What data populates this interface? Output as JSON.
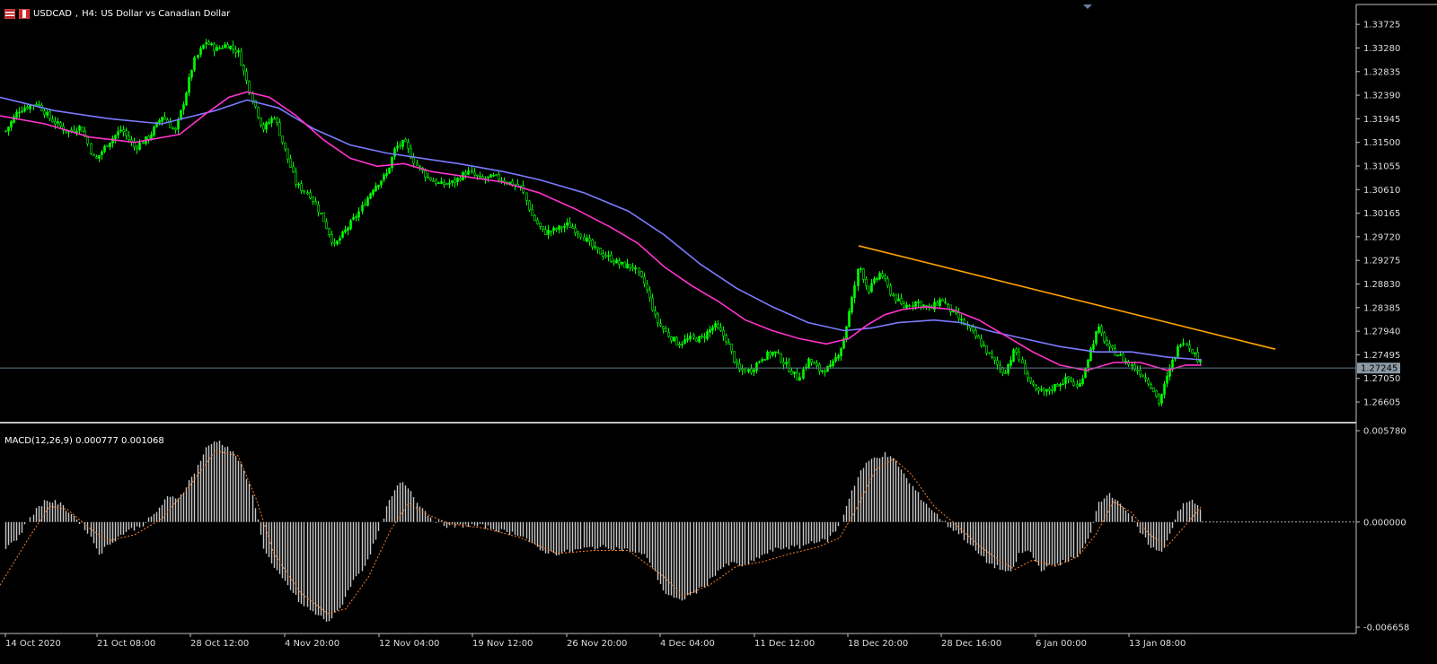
{
  "header": {
    "symbol": "USDCAD",
    "timeframe": "H4:",
    "description": "US Dollar vs Canadian Dollar"
  },
  "indicator": {
    "name": "MACD(12,26,9)",
    "main_value": "0.000777",
    "signal_value": "0.001068"
  },
  "current_price": "1.27245",
  "colors": {
    "background": "#000000",
    "bull_candle": "#00ff00",
    "ma_fast": "#ff33cc",
    "ma_slow": "#7b7bff",
    "trendline": "#ffa500",
    "macd_histogram": "#c8c8c8",
    "macd_signal": "#ff7f27",
    "axis": "#c0c0c0",
    "bid_line": "#607b8b"
  },
  "chart_data": [
    {
      "type": "candlestick",
      "title": "USDCAD, H4:  US Dollar vs Canadian Dollar",
      "x_tick_labels": [
        "14 Oct 2020",
        "21 Oct 08:00",
        "28 Oct 12:00",
        "4 Nov 20:00",
        "12 Nov 04:00",
        "19 Nov 12:00",
        "26 Nov 20:00",
        "4 Dec 04:00",
        "11 Dec 12:00",
        "18 Dec 20:00",
        "28 Dec 16:00",
        "6 Jan 00:00",
        "13 Jan 08:00"
      ],
      "y_tick_labels": [
        "1.33725",
        "1.33280",
        "1.32835",
        "1.32390",
        "1.31945",
        "1.31500",
        "1.31055",
        "1.30610",
        "1.30165",
        "1.29720",
        "1.29275",
        "1.28830",
        "1.28385",
        "1.27940",
        "1.27495",
        "1.27050",
        "1.26605"
      ],
      "ylim": [
        1.2625,
        1.341
      ],
      "close_path": [
        [
          0,
          1.3155
        ],
        [
          20,
          1.321
        ],
        [
          40,
          1.3225
        ],
        [
          55,
          1.3195
        ],
        [
          75,
          1.317
        ],
        [
          90,
          1.318
        ],
        [
          105,
          1.3115
        ],
        [
          120,
          1.315
        ],
        [
          135,
          1.3175
        ],
        [
          150,
          1.314
        ],
        [
          165,
          1.316
        ],
        [
          180,
          1.32
        ],
        [
          195,
          1.317
        ],
        [
          205,
          1.323
        ],
        [
          215,
          1.33
        ],
        [
          228,
          1.334
        ],
        [
          240,
          1.3325
        ],
        [
          252,
          1.3335
        ],
        [
          265,
          1.332
        ],
        [
          278,
          1.3245
        ],
        [
          292,
          1.3175
        ],
        [
          305,
          1.32
        ],
        [
          318,
          1.313
        ],
        [
          330,
          1.307
        ],
        [
          345,
          1.305
        ],
        [
          358,
          1.301
        ],
        [
          372,
          1.2955
        ],
        [
          385,
          1.2985
        ],
        [
          400,
          1.302
        ],
        [
          415,
          1.3065
        ],
        [
          430,
          1.309
        ],
        [
          440,
          1.314
        ],
        [
          450,
          1.315
        ],
        [
          462,
          1.311
        ],
        [
          475,
          1.3085
        ],
        [
          490,
          1.307
        ],
        [
          505,
          1.3075
        ],
        [
          520,
          1.3095
        ],
        [
          535,
          1.308
        ],
        [
          550,
          1.3085
        ],
        [
          565,
          1.3075
        ],
        [
          580,
          1.3065
        ],
        [
          592,
          1.301
        ],
        [
          605,
          1.298
        ],
        [
          618,
          1.2985
        ],
        [
          632,
          1.2995
        ],
        [
          645,
          1.298
        ],
        [
          660,
          1.295
        ],
        [
          675,
          1.2935
        ],
        [
          690,
          1.292
        ],
        [
          705,
          1.2915
        ],
        [
          718,
          1.288
        ],
        [
          730,
          1.2815
        ],
        [
          742,
          1.279
        ],
        [
          755,
          1.277
        ],
        [
          768,
          1.278
        ],
        [
          780,
          1.278
        ],
        [
          795,
          1.2805
        ],
        [
          808,
          1.278
        ],
        [
          822,
          1.272
        ],
        [
          835,
          1.272
        ],
        [
          848,
          1.2745
        ],
        [
          862,
          1.2755
        ],
        [
          875,
          1.273
        ],
        [
          888,
          1.2705
        ],
        [
          900,
          1.274
        ],
        [
          912,
          1.272
        ],
        [
          925,
          1.2725
        ],
        [
          938,
          1.277
        ],
        [
          948,
          1.285
        ],
        [
          956,
          1.292
        ],
        [
          966,
          1.287
        ],
        [
          980,
          1.2905
        ],
        [
          990,
          1.287
        ],
        [
          1005,
          1.284
        ],
        [
          1020,
          1.285
        ],
        [
          1035,
          1.2835
        ],
        [
          1048,
          1.2855
        ],
        [
          1060,
          1.283
        ],
        [
          1075,
          1.2805
        ],
        [
          1090,
          1.2775
        ],
        [
          1105,
          1.274
        ],
        [
          1118,
          1.2715
        ],
        [
          1130,
          1.276
        ],
        [
          1140,
          1.272
        ],
        [
          1152,
          1.268
        ],
        [
          1165,
          1.268
        ],
        [
          1178,
          1.2695
        ],
        [
          1190,
          1.2705
        ],
        [
          1200,
          1.2685
        ],
        [
          1210,
          1.274
        ],
        [
          1222,
          1.28
        ],
        [
          1235,
          1.276
        ],
        [
          1245,
          1.275
        ],
        [
          1258,
          1.273
        ],
        [
          1270,
          1.2715
        ],
        [
          1282,
          1.269
        ],
        [
          1290,
          1.266
        ],
        [
          1298,
          1.27
        ],
        [
          1306,
          1.274
        ],
        [
          1316,
          1.278
        ],
        [
          1326,
          1.276
        ],
        [
          1338,
          1.2728
        ]
      ],
      "ma_fast_path": [
        [
          0,
          1.32
        ],
        [
          50,
          1.3185
        ],
        [
          100,
          1.316
        ],
        [
          150,
          1.315
        ],
        [
          200,
          1.3165
        ],
        [
          230,
          1.3205
        ],
        [
          255,
          1.3235
        ],
        [
          275,
          1.3245
        ],
        [
          300,
          1.3235
        ],
        [
          330,
          1.32
        ],
        [
          360,
          1.3155
        ],
        [
          390,
          1.312
        ],
        [
          420,
          1.3105
        ],
        [
          450,
          1.311
        ],
        [
          480,
          1.3095
        ],
        [
          520,
          1.3085
        ],
        [
          560,
          1.3075
        ],
        [
          600,
          1.3055
        ],
        [
          640,
          1.3025
        ],
        [
          680,
          1.299
        ],
        [
          710,
          1.296
        ],
        [
          740,
          1.2915
        ],
        [
          770,
          1.288
        ],
        [
          800,
          1.285
        ],
        [
          830,
          1.2815
        ],
        [
          860,
          1.2795
        ],
        [
          890,
          1.278
        ],
        [
          920,
          1.277
        ],
        [
          945,
          1.278
        ],
        [
          965,
          1.2805
        ],
        [
          985,
          1.2825
        ],
        [
          1005,
          1.2835
        ],
        [
          1030,
          1.284
        ],
        [
          1060,
          1.2835
        ],
        [
          1090,
          1.2815
        ],
        [
          1120,
          1.2785
        ],
        [
          1150,
          1.2755
        ],
        [
          1180,
          1.273
        ],
        [
          1210,
          1.272
        ],
        [
          1240,
          1.2735
        ],
        [
          1270,
          1.2735
        ],
        [
          1300,
          1.272
        ],
        [
          1320,
          1.273
        ],
        [
          1338,
          1.273
        ]
      ],
      "ma_slow_path": [
        [
          0,
          1.3235
        ],
        [
          60,
          1.321
        ],
        [
          120,
          1.3195
        ],
        [
          180,
          1.3185
        ],
        [
          240,
          1.321
        ],
        [
          275,
          1.323
        ],
        [
          310,
          1.3215
        ],
        [
          350,
          1.3175
        ],
        [
          390,
          1.3145
        ],
        [
          430,
          1.313
        ],
        [
          470,
          1.312
        ],
        [
          510,
          1.311
        ],
        [
          560,
          1.3095
        ],
        [
          600,
          1.308
        ],
        [
          650,
          1.3055
        ],
        [
          700,
          1.302
        ],
        [
          740,
          1.2975
        ],
        [
          780,
          1.292
        ],
        [
          820,
          1.2875
        ],
        [
          860,
          1.284
        ],
        [
          900,
          1.281
        ],
        [
          940,
          1.2795
        ],
        [
          970,
          1.28
        ],
        [
          1000,
          1.281
        ],
        [
          1040,
          1.2815
        ],
        [
          1070,
          1.281
        ],
        [
          1100,
          1.2795
        ],
        [
          1140,
          1.278
        ],
        [
          1180,
          1.2765
        ],
        [
          1220,
          1.2755
        ],
        [
          1260,
          1.2755
        ],
        [
          1300,
          1.2745
        ],
        [
          1338,
          1.274
        ]
      ],
      "trendline": {
        "start": [
          956,
          1.2955
        ],
        "end": [
          1420,
          1.276
        ]
      }
    },
    {
      "type": "bar",
      "title": "MACD(12,26,9) 0.000777 0.001068",
      "y_tick_labels": [
        "0.005780",
        "0.000000",
        "-0.006658"
      ],
      "ylim": [
        -0.006658,
        0.00578
      ],
      "histogram_path": [
        [
          0,
          -0.0018
        ],
        [
          20,
          -0.001
        ],
        [
          35,
          0.0005
        ],
        [
          50,
          0.0014
        ],
        [
          65,
          0.0012
        ],
        [
          80,
          0.0005
        ],
        [
          95,
          -0.0004
        ],
        [
          110,
          -0.002
        ],
        [
          125,
          -0.0012
        ],
        [
          140,
          -0.0006
        ],
        [
          155,
          -0.0003
        ],
        [
          170,
          0.0004
        ],
        [
          185,
          0.0015
        ],
        [
          200,
          0.0016
        ],
        [
          215,
          0.003
        ],
        [
          228,
          0.0046
        ],
        [
          240,
          0.0052
        ],
        [
          252,
          0.0048
        ],
        [
          265,
          0.004
        ],
        [
          280,
          0.002
        ],
        [
          292,
          -0.0015
        ],
        [
          305,
          -0.003
        ],
        [
          320,
          -0.004
        ],
        [
          335,
          -0.0052
        ],
        [
          350,
          -0.0058
        ],
        [
          365,
          -0.0063
        ],
        [
          378,
          -0.0055
        ],
        [
          390,
          -0.004
        ],
        [
          405,
          -0.0028
        ],
        [
          420,
          -0.0008
        ],
        [
          432,
          0.0012
        ],
        [
          445,
          0.0025
        ],
        [
          455,
          0.0022
        ],
        [
          465,
          0.0012
        ],
        [
          480,
          0.0002
        ],
        [
          500,
          -0.0003
        ],
        [
          520,
          -0.0002
        ],
        [
          540,
          -0.0003
        ],
        [
          560,
          -0.0006
        ],
        [
          580,
          -0.0008
        ],
        [
          600,
          -0.0018
        ],
        [
          620,
          -0.002
        ],
        [
          640,
          -0.0018
        ],
        [
          660,
          -0.0016
        ],
        [
          680,
          -0.0016
        ],
        [
          700,
          -0.0018
        ],
        [
          720,
          -0.0022
        ],
        [
          740,
          -0.0045
        ],
        [
          755,
          -0.005
        ],
        [
          770,
          -0.0046
        ],
        [
          785,
          -0.004
        ],
        [
          800,
          -0.003
        ],
        [
          815,
          -0.0026
        ],
        [
          830,
          -0.0028
        ],
        [
          845,
          -0.0022
        ],
        [
          860,
          -0.0018
        ],
        [
          875,
          -0.0016
        ],
        [
          890,
          -0.0016
        ],
        [
          905,
          -0.0012
        ],
        [
          920,
          -0.0012
        ],
        [
          935,
          -0.0002
        ],
        [
          945,
          0.0015
        ],
        [
          958,
          0.0033
        ],
        [
          970,
          0.004
        ],
        [
          985,
          0.0043
        ],
        [
          998,
          0.0038
        ],
        [
          1012,
          0.0025
        ],
        [
          1025,
          0.0015
        ],
        [
          1040,
          0.0006
        ],
        [
          1055,
          -0.0002
        ],
        [
          1070,
          -0.0008
        ],
        [
          1085,
          -0.0018
        ],
        [
          1100,
          -0.0026
        ],
        [
          1115,
          -0.003
        ],
        [
          1125,
          -0.0033
        ],
        [
          1135,
          -0.002
        ],
        [
          1145,
          -0.0018
        ],
        [
          1158,
          -0.003
        ],
        [
          1170,
          -0.0028
        ],
        [
          1185,
          -0.0025
        ],
        [
          1200,
          -0.0022
        ],
        [
          1212,
          -0.001
        ],
        [
          1222,
          0.0012
        ],
        [
          1232,
          0.0018
        ],
        [
          1245,
          0.0014
        ],
        [
          1258,
          0.0004
        ],
        [
          1270,
          -0.0008
        ],
        [
          1282,
          -0.0016
        ],
        [
          1292,
          -0.002
        ],
        [
          1302,
          -0.0008
        ],
        [
          1312,
          0.0008
        ],
        [
          1325,
          0.0014
        ],
        [
          1338,
          0.0008
        ]
      ],
      "signal_path": [
        [
          0,
          -0.004
        ],
        [
          30,
          -0.0012
        ],
        [
          55,
          0.001
        ],
        [
          75,
          0.0008
        ],
        [
          100,
          -0.0004
        ],
        [
          120,
          -0.0012
        ],
        [
          150,
          -0.0008
        ],
        [
          180,
          0.0002
        ],
        [
          210,
          0.0022
        ],
        [
          240,
          0.0045
        ],
        [
          265,
          0.0042
        ],
        [
          285,
          0.0015
        ],
        [
          305,
          -0.002
        ],
        [
          335,
          -0.0045
        ],
        [
          365,
          -0.0058
        ],
        [
          385,
          -0.0055
        ],
        [
          410,
          -0.0035
        ],
        [
          435,
          -0.0005
        ],
        [
          455,
          0.0012
        ],
        [
          475,
          0.0005
        ],
        [
          500,
          -0.0001
        ],
        [
          540,
          -0.0004
        ],
        [
          580,
          -0.001
        ],
        [
          620,
          -0.002
        ],
        [
          660,
          -0.0018
        ],
        [
          700,
          -0.0018
        ],
        [
          740,
          -0.0035
        ],
        [
          760,
          -0.0047
        ],
        [
          790,
          -0.004
        ],
        [
          820,
          -0.0028
        ],
        [
          850,
          -0.0025
        ],
        [
          880,
          -0.002
        ],
        [
          910,
          -0.0016
        ],
        [
          935,
          -0.001
        ],
        [
          955,
          0.001
        ],
        [
          975,
          0.0033
        ],
        [
          995,
          0.004
        ],
        [
          1015,
          0.003
        ],
        [
          1040,
          0.001
        ],
        [
          1065,
          -0.0002
        ],
        [
          1090,
          -0.0015
        ],
        [
          1115,
          -0.0025
        ],
        [
          1130,
          -0.003
        ],
        [
          1150,
          -0.0024
        ],
        [
          1175,
          -0.0028
        ],
        [
          1200,
          -0.0022
        ],
        [
          1220,
          -0.0008
        ],
        [
          1240,
          0.0013
        ],
        [
          1260,
          0.0006
        ],
        [
          1280,
          -0.0008
        ],
        [
          1300,
          -0.0015
        ],
        [
          1320,
          -0.0002
        ],
        [
          1338,
          0.001
        ]
      ]
    }
  ]
}
